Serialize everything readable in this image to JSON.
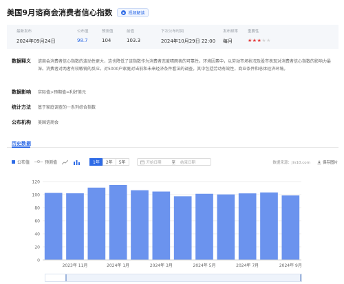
{
  "header": {
    "title": "美国9月谘商会消费者信心指数",
    "video_label": "视频解读"
  },
  "info": {
    "latest_release": {
      "label": "最新发布",
      "value": "2024年09月24日"
    },
    "actual": {
      "label": "公布值",
      "value": "98.7"
    },
    "forecast": {
      "label": "预测值",
      "value": "104"
    },
    "previous": {
      "label": "前值",
      "value": "103.3"
    },
    "next_release": {
      "label": "下次公布时间",
      "value": "2024年10月29日 22:00"
    },
    "frequency": {
      "label": "发布频率",
      "value": "每月"
    },
    "importance": {
      "label": "重要性",
      "stars_on": 3,
      "stars_total": 5
    }
  },
  "details": {
    "definition_label": "数据释义",
    "definition_text": "谘商会消费者信心指数的波动性更大，这也降低了该指数作为消费者态度晴雨表的可靠性。环境因素中，以劳动市场状况及股市表现对消费者信心指数的影响力最深。消费者对两者有较敏锐的反应。对5000户家庭对当前和未来经济条件看法的调查，其中包括劳动有效性，商业条件和总体经济环境。",
    "impact_label": "数据影响",
    "impact_text": "实际值>预期值=利好美元",
    "method_label": "统计方法",
    "method_text": "基于家庭调查的一系列综合指数",
    "publisher_label": "公布机构",
    "publisher_text": "美国谘商会"
  },
  "history": {
    "title": "历史数据",
    "legend_actual": "公布值",
    "legend_forecast": "预测值",
    "ranges": [
      "1年",
      "2年",
      "5年"
    ],
    "active_range": "1年",
    "date_start_placeholder": "开始日期",
    "date_sep": "至",
    "date_end_placeholder": "结束日期",
    "source": "数据来源：Jin10.com",
    "save_label": "保存图片"
  },
  "colors": {
    "accent": "#2e6be6",
    "bar": "#6b93ee",
    "stars": "#e33b3b"
  },
  "chart_data": {
    "type": "bar",
    "categories": [
      "2023年 10月",
      "2023年 11月",
      "2023年 12月",
      "2024年 1月",
      "2024年 2月",
      "2024年 3月",
      "2024年 4月",
      "2024年 5月",
      "2024年 6月",
      "2024年 7月",
      "2024年 8月",
      "2024年 9月"
    ],
    "x_tick_labels": [
      "2023年 11月",
      "2024年 1月",
      "2024年 3月",
      "2024年 5月",
      "2024年 7月",
      "2024年 9月"
    ],
    "series": [
      {
        "name": "公布值",
        "values": [
          102.6,
          102.0,
          110.7,
          114.8,
          106.7,
          104.7,
          97.5,
          101.3,
          100.3,
          101.9,
          103.3,
          98.7
        ]
      }
    ],
    "ylim": [
      0,
      120
    ],
    "yticks": [
      0,
      20,
      40,
      60,
      80,
      100,
      120
    ],
    "grid": true
  }
}
